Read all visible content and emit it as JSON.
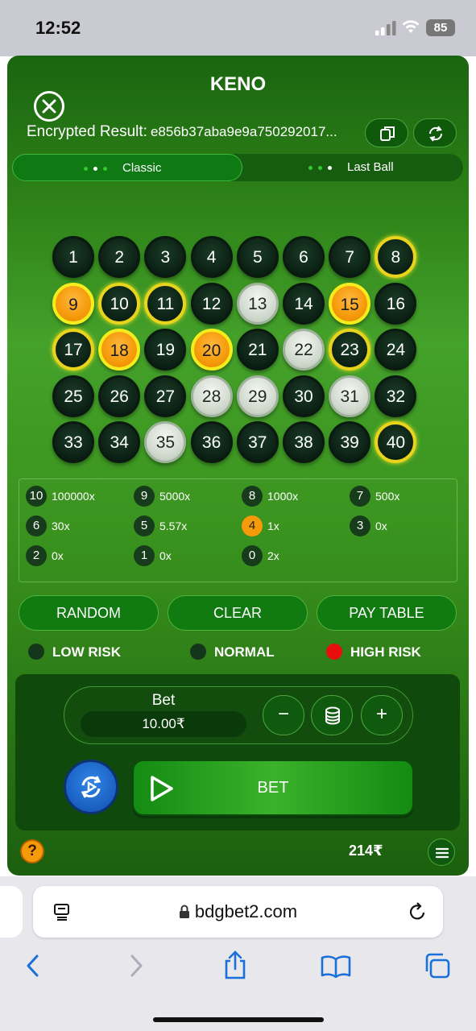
{
  "status_bar": {
    "time": "12:52",
    "battery": "85"
  },
  "game": {
    "title": "KENO",
    "encrypted_label": "Encrypted Result:",
    "encrypted_hash": "e856b37aba9e9a750292017...",
    "modes": [
      "Classic",
      "Last Ball"
    ],
    "active_mode": "Classic",
    "numbers": [
      {
        "n": "1",
        "s": "normal"
      },
      {
        "n": "2",
        "s": "normal"
      },
      {
        "n": "3",
        "s": "normal"
      },
      {
        "n": "4",
        "s": "normal"
      },
      {
        "n": "5",
        "s": "normal"
      },
      {
        "n": "6",
        "s": "normal"
      },
      {
        "n": "7",
        "s": "normal"
      },
      {
        "n": "8",
        "s": "selected"
      },
      {
        "n": "9",
        "s": "hit"
      },
      {
        "n": "10",
        "s": "selected"
      },
      {
        "n": "11",
        "s": "selected"
      },
      {
        "n": "12",
        "s": "normal"
      },
      {
        "n": "13",
        "s": "drawn"
      },
      {
        "n": "14",
        "s": "normal"
      },
      {
        "n": "15",
        "s": "hit"
      },
      {
        "n": "16",
        "s": "normal"
      },
      {
        "n": "17",
        "s": "selected"
      },
      {
        "n": "18",
        "s": "hit"
      },
      {
        "n": "19",
        "s": "normal"
      },
      {
        "n": "20",
        "s": "hit"
      },
      {
        "n": "21",
        "s": "normal"
      },
      {
        "n": "22",
        "s": "drawn"
      },
      {
        "n": "23",
        "s": "selected"
      },
      {
        "n": "24",
        "s": "normal"
      },
      {
        "n": "25",
        "s": "normal"
      },
      {
        "n": "26",
        "s": "normal"
      },
      {
        "n": "27",
        "s": "normal"
      },
      {
        "n": "28",
        "s": "drawn"
      },
      {
        "n": "29",
        "s": "drawn"
      },
      {
        "n": "30",
        "s": "normal"
      },
      {
        "n": "31",
        "s": "drawn"
      },
      {
        "n": "32",
        "s": "normal"
      },
      {
        "n": "33",
        "s": "normal"
      },
      {
        "n": "34",
        "s": "normal"
      },
      {
        "n": "35",
        "s": "drawn"
      },
      {
        "n": "36",
        "s": "normal"
      },
      {
        "n": "37",
        "s": "normal"
      },
      {
        "n": "38",
        "s": "normal"
      },
      {
        "n": "39",
        "s": "normal"
      },
      {
        "n": "40",
        "s": "selected"
      }
    ],
    "paytable": [
      {
        "hits": "10",
        "multiplier": "100000x",
        "highlight": false
      },
      {
        "hits": "9",
        "multiplier": "5000x",
        "highlight": false
      },
      {
        "hits": "8",
        "multiplier": "1000x",
        "highlight": false
      },
      {
        "hits": "7",
        "multiplier": "500x",
        "highlight": false
      },
      {
        "hits": "6",
        "multiplier": "30x",
        "highlight": false
      },
      {
        "hits": "5",
        "multiplier": "5.57x",
        "highlight": false
      },
      {
        "hits": "4",
        "multiplier": "1x",
        "highlight": true
      },
      {
        "hits": "3",
        "multiplier": "0x",
        "highlight": false
      },
      {
        "hits": "2",
        "multiplier": "0x",
        "highlight": false
      },
      {
        "hits": "1",
        "multiplier": "0x",
        "highlight": false
      },
      {
        "hits": "0",
        "multiplier": "2x",
        "highlight": false
      }
    ],
    "actions": {
      "random": "RANDOM",
      "clear": "CLEAR",
      "pay_table": "PAY TABLE"
    },
    "risk": {
      "low": "LOW RISK",
      "normal": "NORMAL",
      "high": "HIGH RISK",
      "selected": "HIGH RISK"
    },
    "bet": {
      "label": "Bet",
      "value": "10.00₹",
      "minus": "−",
      "plus": "+"
    },
    "bet_button": "BET",
    "help": "?",
    "balance": "214₹"
  },
  "browser": {
    "url": "bdgbet2.com"
  },
  "colors": {
    "accent_green": "#2e8218",
    "hit_orange": "#f59a0a",
    "selected_yellow": "#e8d41c",
    "risk_red": "#e80e0e"
  }
}
